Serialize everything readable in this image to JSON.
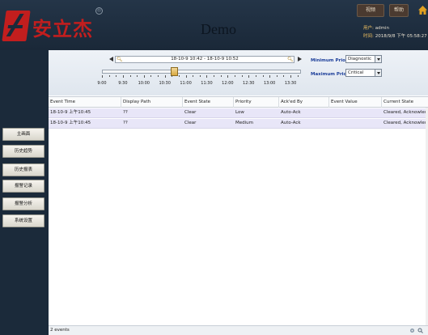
{
  "header": {
    "logo_text": "安立杰",
    "logo_reg": "®",
    "title": "Demo",
    "buttons": [
      "视频",
      "帮助"
    ],
    "user_label": "用户:",
    "user_value": "admin",
    "time_label": "时间:",
    "time_value": "2018/9/8 下午 05:58:27"
  },
  "sidebar": {
    "items": [
      {
        "label": "主画面"
      },
      {
        "label": "历史趋势"
      },
      {
        "label": "历史报表"
      },
      {
        "label": "报警记录"
      },
      {
        "label": "报警分析"
      },
      {
        "label": "系统设置"
      }
    ]
  },
  "controls": {
    "time_range": "18-10-9 10:42 - 18-10-9 10:52",
    "timeline_ticks": [
      "9:00",
      "9:30",
      "10:00",
      "10:30",
      "11:00",
      "11:30",
      "12:00",
      "12:30",
      "13:00",
      "13:30"
    ],
    "min_priority_label": "Minimum Priority:",
    "min_priority_value": "Diagnostic",
    "max_priority_label": "Maximum Priority:",
    "max_priority_value": "Critical"
  },
  "table": {
    "columns": [
      "Event Time",
      "Display Path",
      "Event State",
      "Priority",
      "Ack'ed By",
      "Event Value",
      "Current State"
    ],
    "rows": [
      [
        "18-10-9 上午10:45",
        "??",
        "Clear",
        "Low",
        "Auto-Ack",
        "",
        "Cleared, Acknowledged"
      ],
      [
        "18-10-9 上午10:45",
        "??",
        "Clear",
        "Medium",
        "Auto-Ack",
        "",
        "Cleared, Acknowledged"
      ]
    ]
  },
  "status": {
    "text": "2 events"
  }
}
